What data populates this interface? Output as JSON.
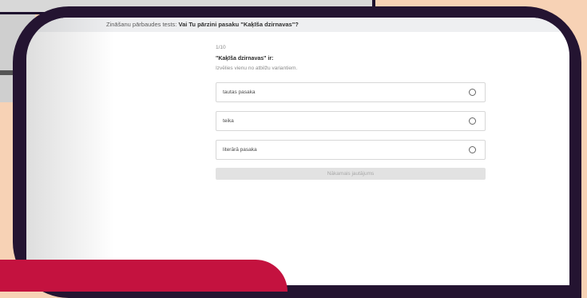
{
  "header": {
    "prefix": "Zināšanu pārbaudes tests:",
    "title": "Vai Tu pārzini pasaku \"Kaķīša dzirnavas\"?"
  },
  "quiz": {
    "counter": "1/10",
    "question": "\"Kaķīša dzirnavas\" ir:",
    "instruction": "Izvēlies vienu no atbilžu variantiem.",
    "options": [
      {
        "label": "tautas pasaka"
      },
      {
        "label": "teika"
      },
      {
        "label": "literārā pasaka"
      }
    ],
    "next_label": "Nākamais jautājums"
  },
  "colors": {
    "background": "#f7d2b5",
    "phone_frame": "#241431",
    "accent_red": "#c4123f"
  }
}
